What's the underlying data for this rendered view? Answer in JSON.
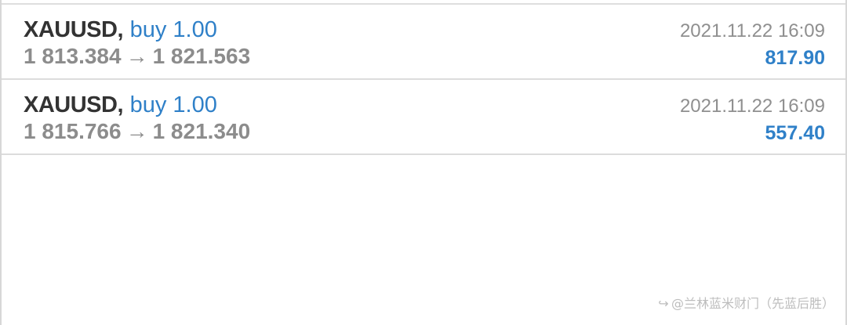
{
  "trades": [
    {
      "symbol": "XAUUSD",
      "separator": ",",
      "side": "buy 1.00",
      "open_price": "1 813.384",
      "arrow": "→",
      "close_price": "1 821.563",
      "time": "2021.11.22 16:09",
      "profit": "817.90"
    },
    {
      "symbol": "XAUUSD",
      "separator": ",",
      "side": "buy 1.00",
      "open_price": "1 815.766",
      "arrow": "→",
      "close_price": "1 821.340",
      "time": "2021.11.22 16:09",
      "profit": "557.40"
    }
  ],
  "watermark": {
    "icon": "share-arrow-icon",
    "text": "@兰林蓝米财门（先蓝后胜）"
  },
  "colors": {
    "symbol": "#333333",
    "buy": "#2f80c8",
    "profit": "#2f80c8",
    "muted": "#8c8c8c",
    "divider": "#dcdcdc",
    "background": "#ffffff"
  }
}
